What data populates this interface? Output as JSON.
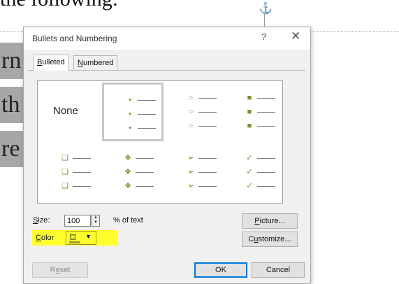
{
  "document": {
    "top_text": "the following:",
    "lines": [
      "rn",
      "th",
      "re"
    ]
  },
  "dialog": {
    "title": "Bullets and Numbering",
    "help": "?",
    "close": "✕",
    "tabs": [
      {
        "label": "Bulleted",
        "accel": "B",
        "rest": "ulleted",
        "active": true
      },
      {
        "label": "Numbered",
        "accel": "N",
        "rest": "umbered",
        "active": false
      }
    ],
    "gallery": {
      "none_label": "None",
      "selected_index": 1,
      "bullet_styles": [
        {
          "name": "none"
        },
        {
          "name": "small-dot",
          "glyph": "•",
          "color": "#8a8a2a"
        },
        {
          "name": "hollow-circle",
          "glyph": "○",
          "color": "#8a8a2a"
        },
        {
          "name": "filled-square",
          "glyph": "■",
          "color": "#8a8a2a"
        },
        {
          "name": "hollow-square",
          "glyph": "❑",
          "color": "#8a8a2a"
        },
        {
          "name": "four-diamond",
          "glyph": "❖",
          "color": "#8a8a2a"
        },
        {
          "name": "arrowhead",
          "glyph": "➢",
          "color": "#8a8a2a"
        },
        {
          "name": "checkmark",
          "glyph": "✓",
          "color": "#8a8a2a"
        }
      ]
    },
    "size": {
      "label": "Size:",
      "accel": "S",
      "rest": "ize:",
      "value": "100",
      "unit_label": "% of text"
    },
    "color": {
      "label": "Color",
      "accel": "C",
      "rest": "olor",
      "current_color": "#9b9b3b",
      "highlight_color": "#ffff2e"
    },
    "buttons": {
      "picture": {
        "accel": "P",
        "rest": "icture..."
      },
      "customize": {
        "pre": "C",
        "accel": "u",
        "rest": "stomize..."
      },
      "reset": {
        "pre": "R",
        "accel": "e",
        "rest": "set"
      },
      "ok": "OK",
      "cancel": "Cancel"
    }
  }
}
